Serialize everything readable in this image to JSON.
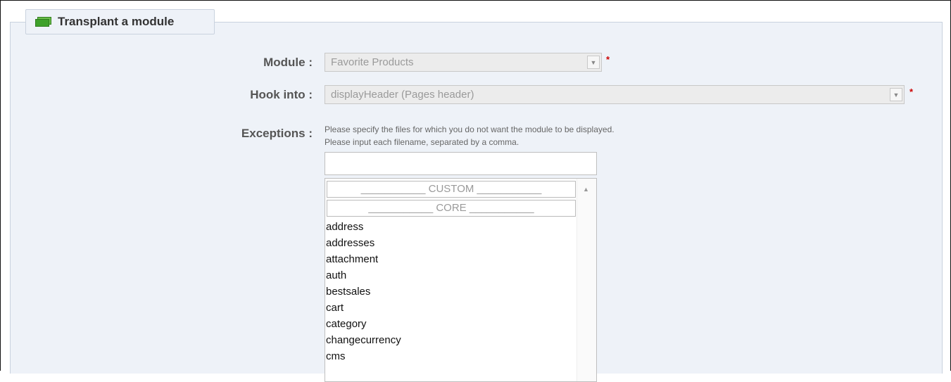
{
  "panel": {
    "title": "Transplant a module",
    "title_icon": "stacked-modules-icon"
  },
  "form": {
    "module": {
      "label": "Module :",
      "value": "Favorite Products",
      "required_mark": "*"
    },
    "hook": {
      "label": "Hook into :",
      "value": "displayHeader (Pages header)",
      "required_mark": "*"
    },
    "exceptions": {
      "label": "Exceptions :",
      "help_line1": "Please specify the files for which you do not want the module to be displayed.",
      "help_line2": "Please input each filename, separated by a comma.",
      "input_value": "",
      "groups": [
        "___________ CUSTOM ___________",
        "___________ CORE ___________"
      ],
      "items": [
        "address",
        "addresses",
        "attachment",
        "auth",
        "bestsales",
        "cart",
        "category",
        "changecurrency",
        "cms"
      ]
    }
  },
  "colors": {
    "panel_bg": "#eef2f8",
    "required": "#cc0000",
    "disabled_select_bg": "#ececec"
  }
}
